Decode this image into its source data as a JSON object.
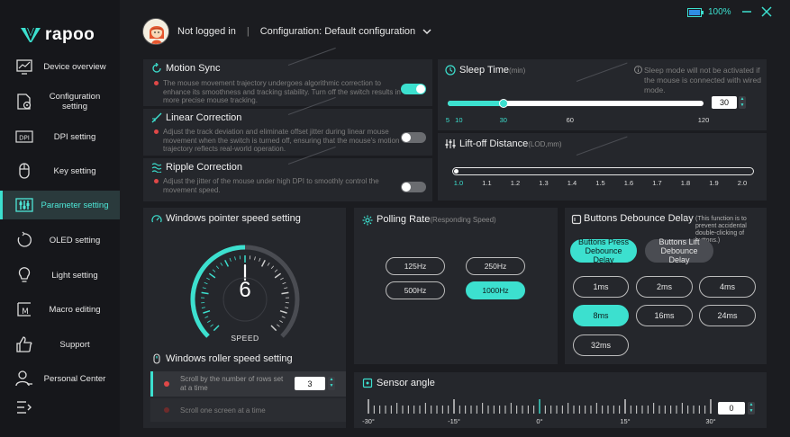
{
  "brand": {
    "logo": "rapoo",
    "accent": "#3ce0cf"
  },
  "window": {
    "battery_percent": "100%",
    "minimize_icon": "minimize-icon",
    "close_icon": "close-icon"
  },
  "header": {
    "login_status": "Not logged in",
    "separator": "|",
    "configuration": "Configuration: Default configuration"
  },
  "sidebar": {
    "items": [
      {
        "label": "Device overview",
        "icon": "monitor-chart-icon"
      },
      {
        "label": "Configuration setting",
        "icon": "doc-gear-icon"
      },
      {
        "label": "DPI setting",
        "icon": "dpi-icon"
      },
      {
        "label": "Key setting",
        "icon": "mouse-icon"
      },
      {
        "label": "Parameter setting",
        "icon": "sliders-icon",
        "active": true
      },
      {
        "label": "OLED setting",
        "icon": "oled-icon"
      },
      {
        "label": "Light setting",
        "icon": "bulb-icon"
      },
      {
        "label": "Macro editing",
        "icon": "macro-icon"
      },
      {
        "label": "Support",
        "icon": "thumbs-up-icon"
      },
      {
        "label": "Personal Center",
        "icon": "person-icon"
      }
    ],
    "collapse_icon": "collapse-menu-icon"
  },
  "motion_sync": {
    "title": "Motion Sync",
    "description": "The mouse movement trajectory undergoes algorithmic correction to enhance its smoothness and tracking stability. Turn off the switch results in more precise mouse tracking.",
    "enabled": true
  },
  "linear_correction": {
    "title": "Linear Correction",
    "description": "Adjust the track deviation and eliminate offset jitter during linear mouse movement when the switch is turned off, ensuring that the mouse's motion trajectory reflects real-world operation.",
    "enabled": false
  },
  "ripple_correction": {
    "title": "Ripple Correction",
    "description": "Adjust the jitter of the mouse under high DPI to smoothly control the movement speed.",
    "enabled": false
  },
  "sleep_time": {
    "title": "Sleep Time",
    "unit": "(min)",
    "note": "Sleep mode will not be activated if the mouse is connected with wired mode.",
    "value": "30",
    "min": 5,
    "max": 120,
    "ticks": [
      "5",
      "10",
      "30",
      "60",
      "120"
    ]
  },
  "lift_off": {
    "title": "Lift-off Distance",
    "unit": "(LOD,mm)",
    "value": 1.0,
    "ticks": [
      "1.0",
      "1.1",
      "1.2",
      "1.3",
      "1.4",
      "1.5",
      "1.6",
      "1.7",
      "1.8",
      "1.9",
      "2.0"
    ]
  },
  "pointer_speed": {
    "title": "Windows pointer speed setting",
    "value": "6",
    "caption": "SPEED",
    "level_fraction": 0.5
  },
  "roller_speed": {
    "title": "Windows roller speed setting",
    "option_rows": "Scroll by the number of rows set at a time",
    "rows_value": "3",
    "option_screen": "Scroll one screen at a time"
  },
  "polling_rate": {
    "title": "Polling Rate",
    "subtitle": "(Responding Speed)",
    "options": [
      "125Hz",
      "250Hz",
      "500Hz",
      "1000Hz"
    ],
    "selected": "1000Hz"
  },
  "debounce": {
    "title": "Buttons Debounce Delay",
    "subtitle": "(This function is to prevent accidental double-clicking of buttons.)",
    "mode_press": "Buttons Press Debounce Delay",
    "mode_lift": "Buttons Lift Debounce Delay",
    "options": [
      "1ms",
      "2ms",
      "4ms",
      "8ms",
      "16ms",
      "24ms",
      "32ms"
    ],
    "selected": "8ms"
  },
  "sensor_angle": {
    "title": "Sensor angle",
    "value": "0",
    "ticks": [
      "-30°",
      "-15°",
      "0°",
      "15°",
      "30°"
    ]
  }
}
